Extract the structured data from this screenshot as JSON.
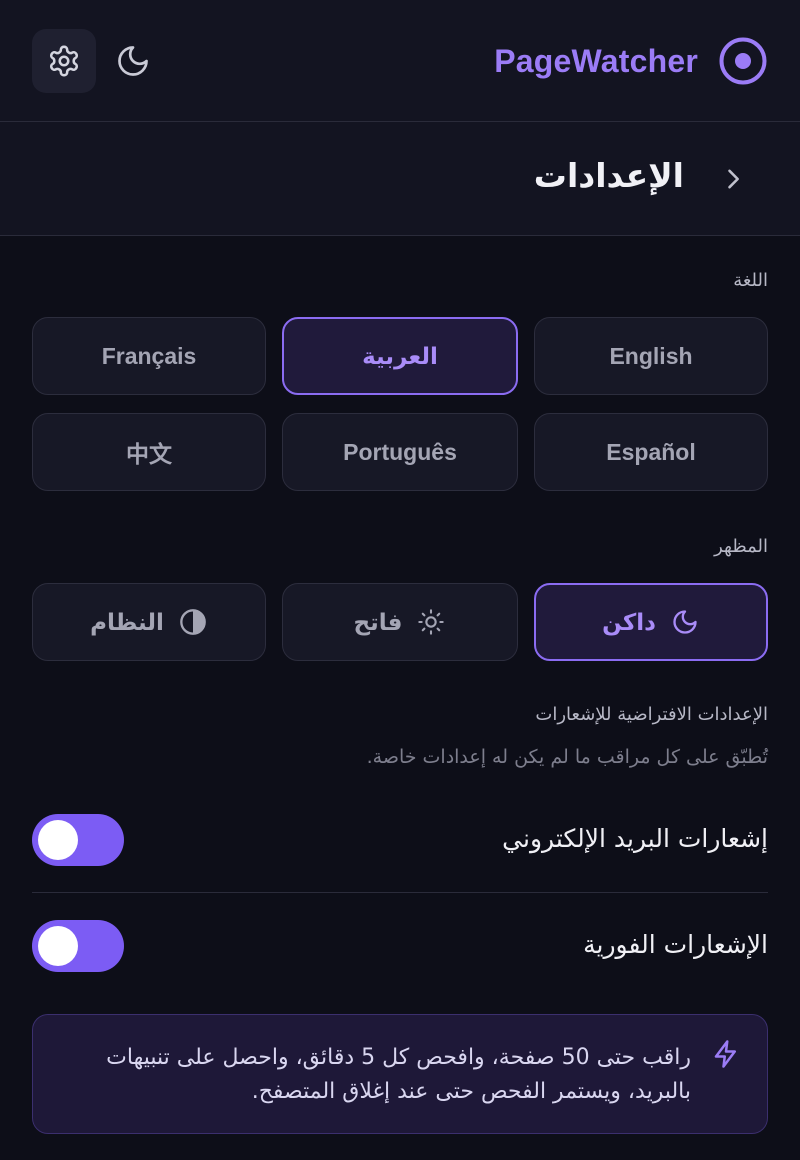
{
  "header": {
    "brand": "PageWatcher",
    "colors": {
      "accent": "#9b7cf6",
      "background": "#0d0e18",
      "panel": "#131421"
    },
    "icons": {
      "settings": "gear-icon",
      "theme": "moon-icon",
      "logo": "target-logo-icon"
    }
  },
  "subbar": {
    "title": "الإعدادات",
    "back_icon": "chevron-right-icon"
  },
  "language": {
    "label": "اللغة",
    "options": [
      "English",
      "العربية",
      "Français",
      "Español",
      "Português",
      "中文"
    ],
    "selected": "العربية"
  },
  "appearance": {
    "label": "المظهر",
    "options": [
      {
        "label": "داكن",
        "icon": "moon-icon"
      },
      {
        "label": "فاتح",
        "icon": "sun-icon"
      },
      {
        "label": "النظام",
        "icon": "half-circle-icon"
      }
    ],
    "selected": "داكن"
  },
  "notifications": {
    "title": "الإعدادات الافتراضية للإشعارات",
    "subtitle": "تُطبّق على كل مراقب ما لم يكن له إعدادات خاصة.",
    "email_label": "إشعارات البريد الإلكتروني",
    "push_label": "الإشعارات الفورية"
  },
  "info": {
    "text": "راقب حتى 50 صفحة، وافحص كل 5 دقائق، واحصل على تنبيهات بالبريد، ويستمر الفحص حتى عند إغلاق المتصفح.",
    "icon": "bolt-icon"
  }
}
